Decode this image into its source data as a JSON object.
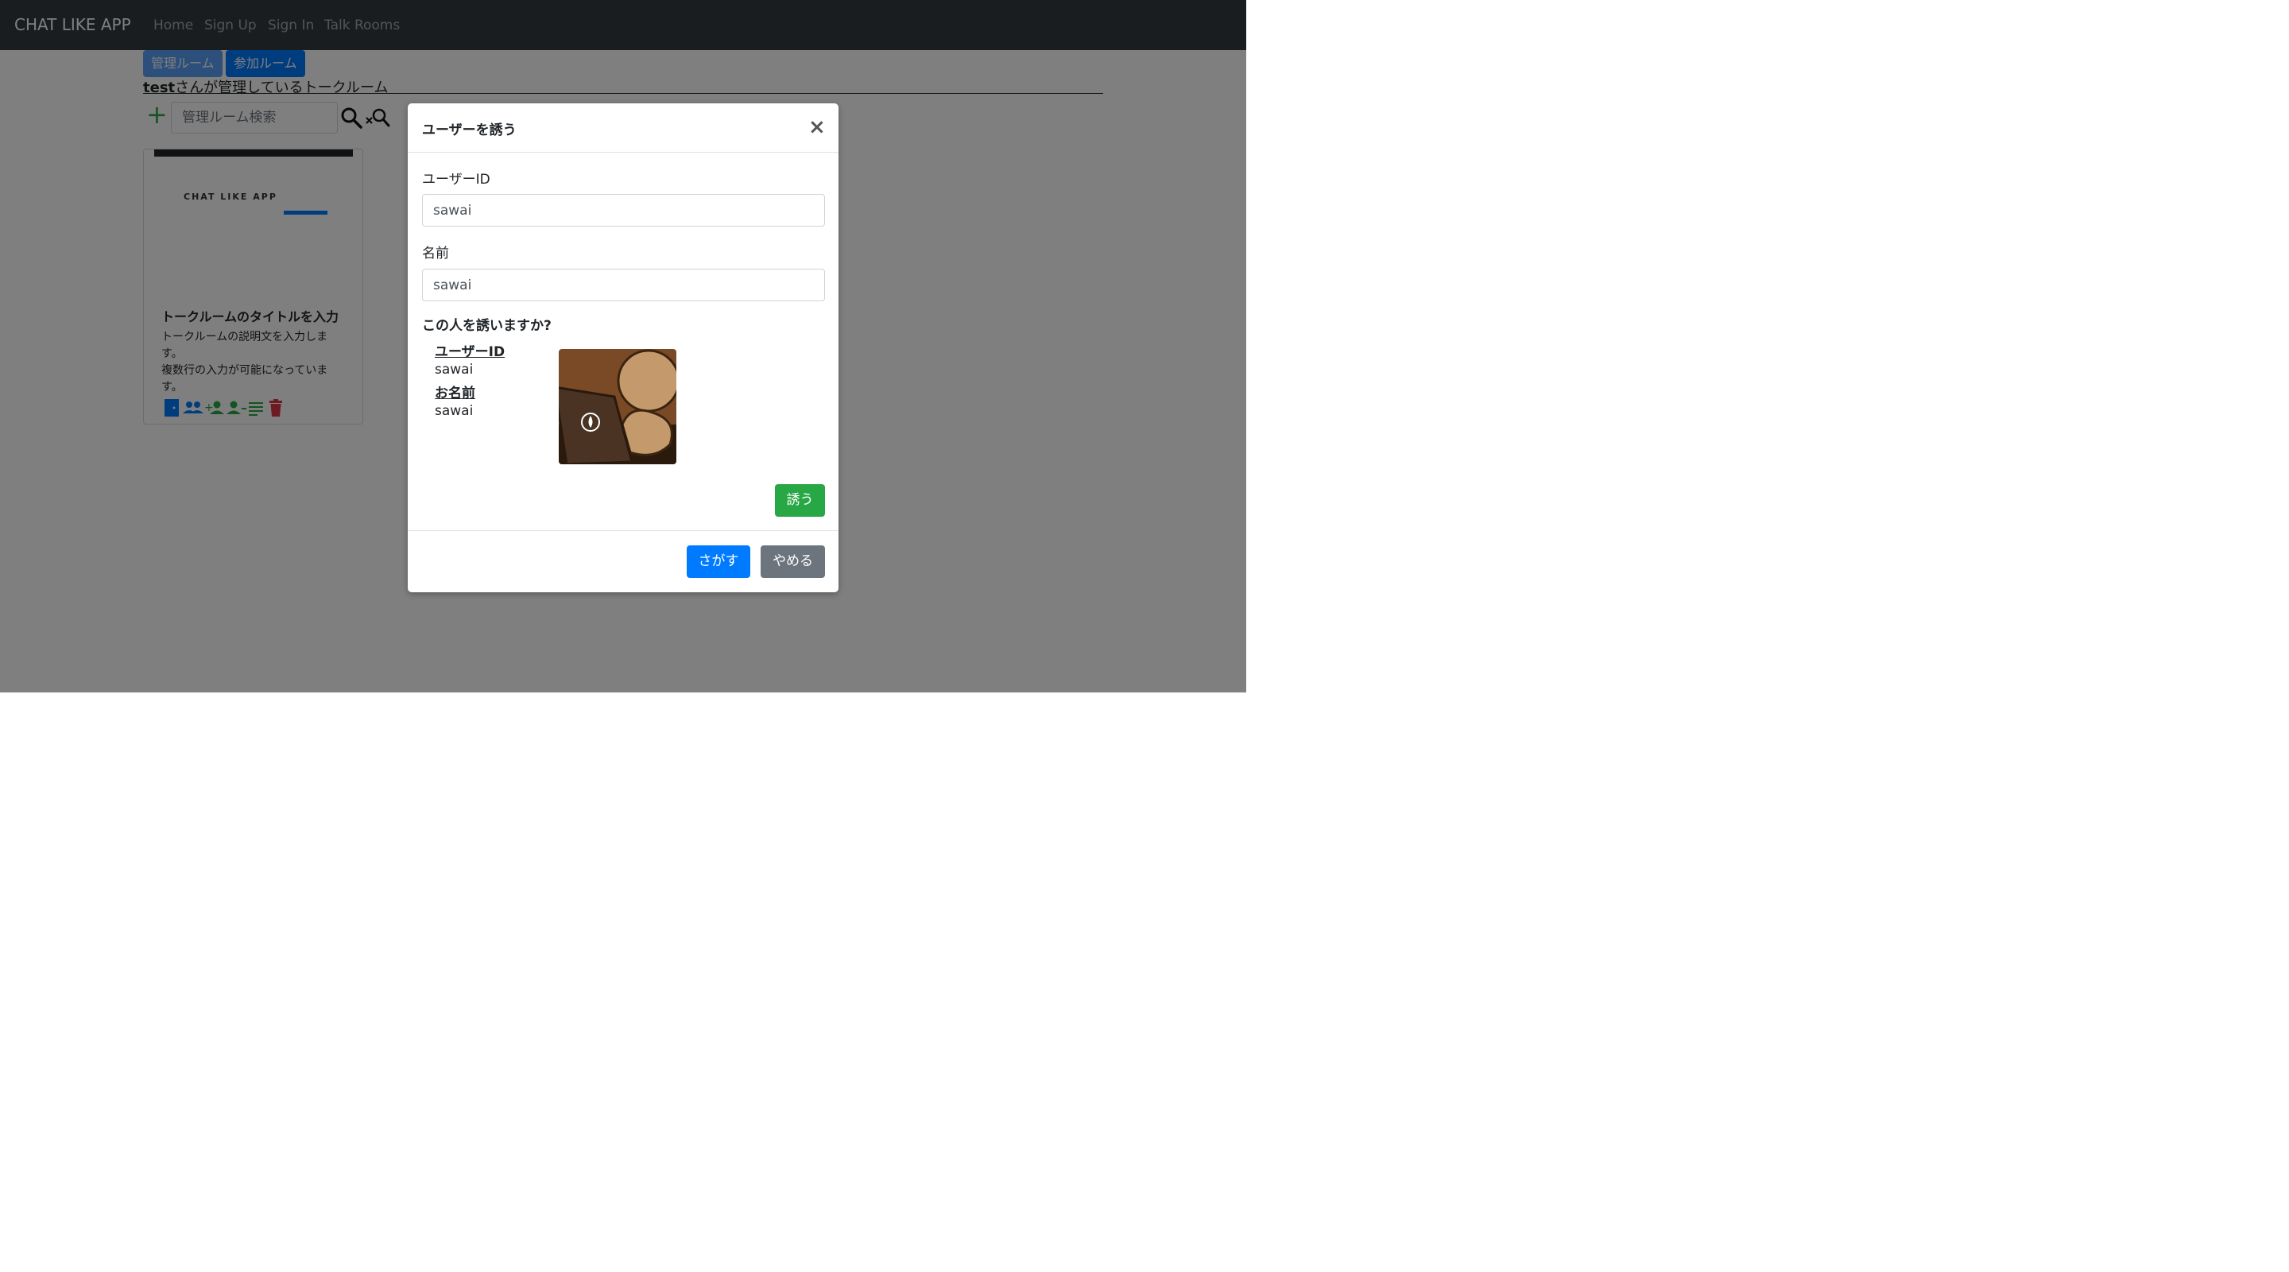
{
  "navbar": {
    "brand": "CHAT LIKE APP",
    "links": [
      "Home",
      "Sign Up",
      "Sign In",
      "Talk Rooms"
    ]
  },
  "tabs": {
    "managed": "管理ルーム",
    "joined": "参加ルーム"
  },
  "heading": {
    "user": "test",
    "suffix": "さんが管理しているトークルーム"
  },
  "search": {
    "placeholder": "管理ルーム検索"
  },
  "card": {
    "thumb_logo": "CHAT LIKE APP",
    "title": "トークルームのタイトルを入力します",
    "description": "トークルームの説明文を入力します。\n複数行の入力が可能になっています。"
  },
  "modal": {
    "title": "ユーザーを誘う",
    "close": "×",
    "user_id_label": "ユーザーID",
    "user_id_value": "sawai",
    "name_label": "名前",
    "name_value": "sawai",
    "confirm_text": "この人を誘いますか?",
    "info": {
      "user_id_heading": "ユーザーID",
      "user_id": "sawai",
      "name_heading": "お名前",
      "name": "sawai"
    },
    "invite_button": "誘う",
    "search_button": "さがす",
    "cancel_button": "やめる"
  },
  "colors": {
    "primary": "#007bff",
    "success": "#28a745",
    "secondary": "#6c757d",
    "danger": "#dc3545",
    "navbar": "#343a40"
  }
}
